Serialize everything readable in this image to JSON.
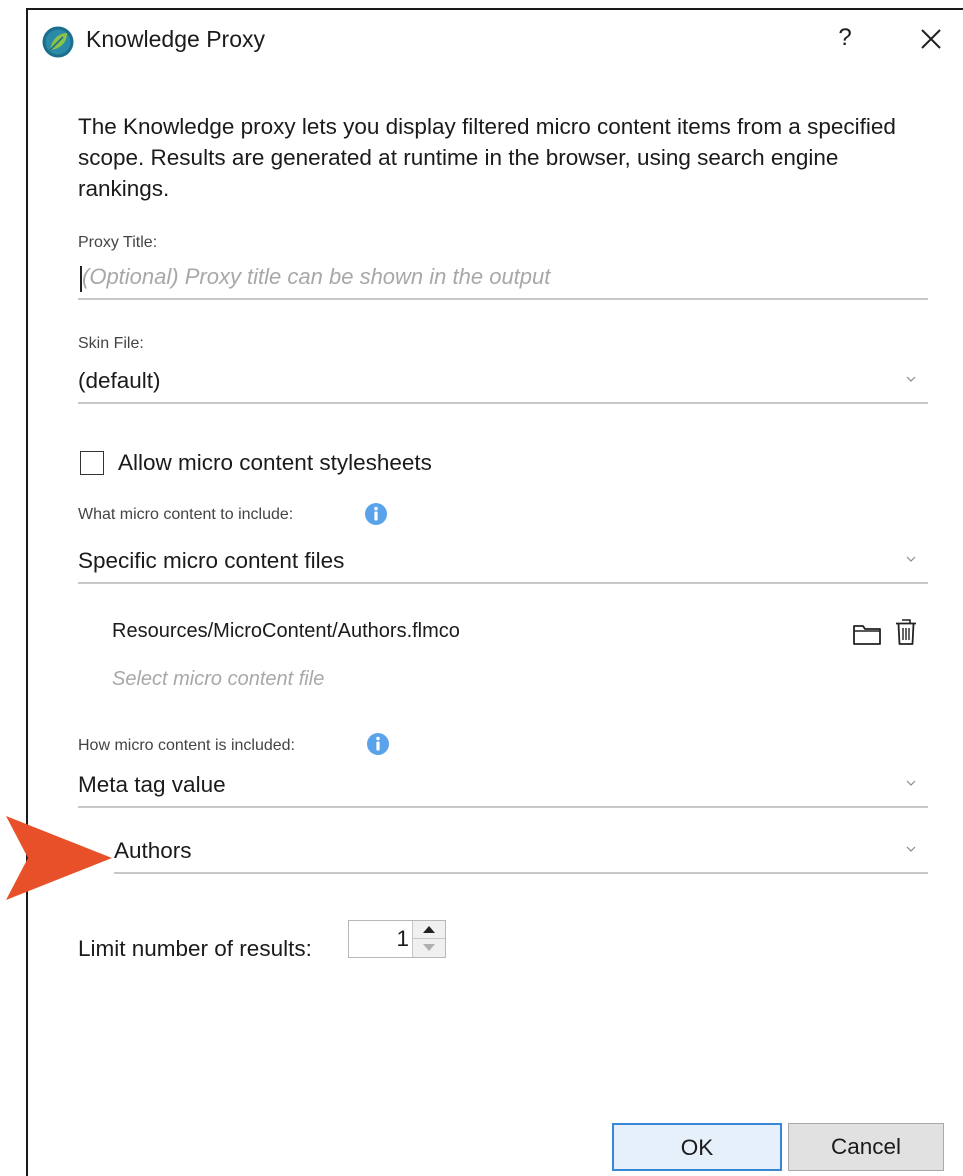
{
  "window": {
    "title": "Knowledge Proxy",
    "help_label": "?",
    "close_icon": "close-icon",
    "logo_icon": "flare-leaf-logo"
  },
  "description": "The Knowledge proxy lets you display filtered micro content items from a specified scope. Results are generated at runtime in the browser, using search engine rankings.",
  "proxy_title": {
    "label": "Proxy Title:",
    "value": "",
    "placeholder": "(Optional) Proxy title can be shown in the output"
  },
  "skin_file": {
    "label": "Skin File:",
    "value": "(default)"
  },
  "allow_stylesheets": {
    "label": "Allow micro content stylesheets",
    "checked": false
  },
  "what_to_include": {
    "label": "What micro content to include:",
    "value": "Specific micro content files",
    "info_icon": "info-icon"
  },
  "files": {
    "items": [
      "Resources/MicroContent/Authors.flmco"
    ],
    "select_placeholder": "Select micro content file",
    "folder_icon": "folder-icon",
    "trash_icon": "trash-icon"
  },
  "how_included": {
    "label": "How micro content is included:",
    "value": "Meta tag value",
    "info_icon": "info-icon"
  },
  "meta_tag": {
    "value": "Authors"
  },
  "limit": {
    "label": "Limit number of results:",
    "value": "1"
  },
  "buttons": {
    "ok": "OK",
    "cancel": "Cancel"
  },
  "colors": {
    "accent": "#3a86d6",
    "annotation_arrow": "#e8502a",
    "info": "#4a9ae8",
    "logo_green": "#7cb342",
    "logo_blue": "#1b6e8c"
  }
}
